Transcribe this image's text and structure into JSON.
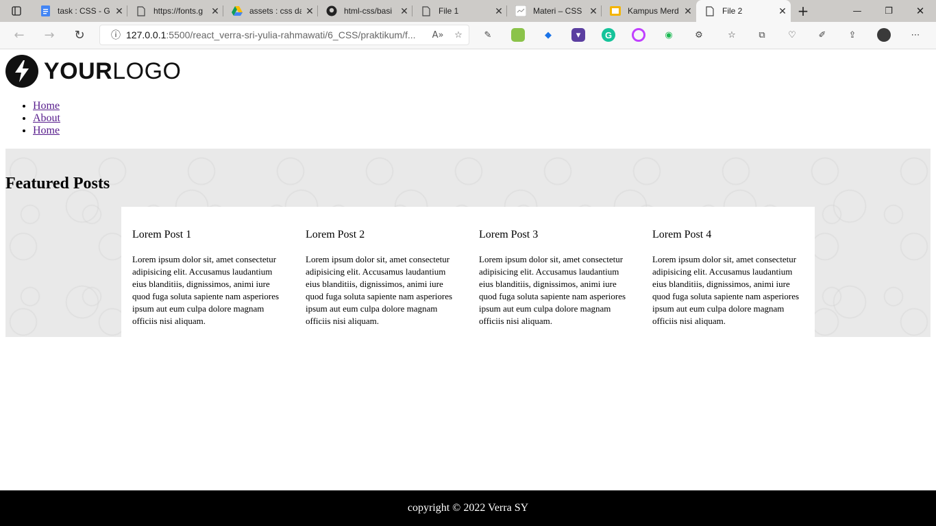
{
  "browser": {
    "tabs": [
      {
        "title": "task : CSS - G",
        "icon": "google-docs-icon",
        "active": false
      },
      {
        "title": "https://fonts.g",
        "icon": "page-icon",
        "active": false
      },
      {
        "title": "assets : css da",
        "icon": "google-drive-icon",
        "active": false
      },
      {
        "title": "html-css/basi",
        "icon": "github-icon",
        "active": false
      },
      {
        "title": "File 1",
        "icon": "page-icon",
        "active": false
      },
      {
        "title": "Materi – CSS",
        "icon": "materi-icon",
        "active": false
      },
      {
        "title": "Kampus Merd",
        "icon": "slides-icon",
        "active": false
      },
      {
        "title": "File 2",
        "icon": "page-icon",
        "active": true
      }
    ],
    "address": {
      "host": "127.0.0.1",
      "path": ":5500/react_verra-sri-yulia-rahmawati/6_CSS/praktikum/f..."
    }
  },
  "page": {
    "logo": {
      "bold": "YOUR",
      "rest": "LOGO"
    },
    "nav": [
      "Home",
      "About",
      "Home"
    ],
    "featured_title": "Featured Posts",
    "posts": [
      {
        "title": "Lorem Post 1",
        "body": "Lorem ipsum dolor sit, amet consectetur adipisicing elit. Accusamus laudantium eius blanditiis, dignissimos, animi iure quod fuga soluta sapiente nam asperiores ipsum aut eum culpa dolore magnam officiis nisi aliquam."
      },
      {
        "title": "Lorem Post 2",
        "body": "Lorem ipsum dolor sit, amet consectetur adipisicing elit. Accusamus laudantium eius blanditiis, dignissimos, animi iure quod fuga soluta sapiente nam asperiores ipsum aut eum culpa dolore magnam officiis nisi aliquam."
      },
      {
        "title": "Lorem Post 3",
        "body": "Lorem ipsum dolor sit, amet consectetur adipisicing elit. Accusamus laudantium eius blanditiis, dignissimos, animi iure quod fuga soluta sapiente nam asperiores ipsum aut eum culpa dolore magnam officiis nisi aliquam."
      },
      {
        "title": "Lorem Post 4",
        "body": "Lorem ipsum dolor sit, amet consectetur adipisicing elit. Accusamus laudantium eius blanditiis, dignissimos, animi iure quod fuga soluta sapiente nam asperiores ipsum aut eum culpa dolore magnam officiis nisi aliquam."
      }
    ],
    "footer": "copyright © 2022 Verra SY"
  }
}
